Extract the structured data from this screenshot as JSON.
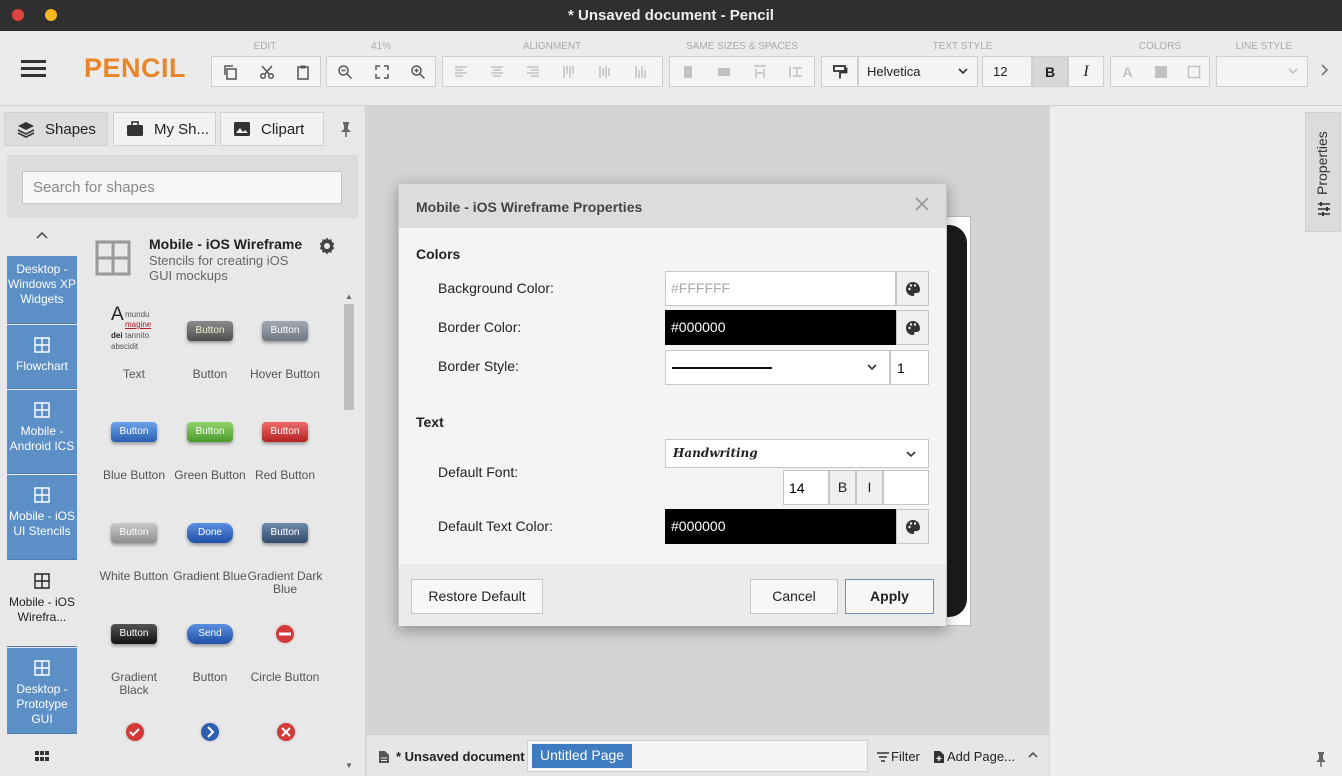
{
  "window": {
    "title": "* Unsaved document - Pencil"
  },
  "app": {
    "logo": "PENCIL"
  },
  "toolbar": {
    "groups": {
      "edit": "EDIT",
      "zoom": "41%",
      "alignment": "ALIGNMENT",
      "same_sizes": "SAME SIZES & SPACES",
      "text_style": "TEXT STYLE",
      "colors": "COLORS",
      "line_style": "LINE STYLE"
    },
    "font_family": "Helvetica",
    "font_size": "12",
    "bold_label": "B",
    "italic_label": "I"
  },
  "left_panel": {
    "tabs": [
      {
        "label": "Shapes",
        "icon": "layers-icon"
      },
      {
        "label": "My Sh...",
        "icon": "briefcase-icon"
      },
      {
        "label": "Clipart",
        "icon": "image-icon"
      }
    ],
    "search": {
      "placeholder": "Search for shapes"
    },
    "collections": [
      {
        "label": "Desktop - Windows XP Widgets"
      },
      {
        "label": "Flowchart"
      },
      {
        "label": "Mobile - Android ICS"
      },
      {
        "label": "Mobile - iOS UI Stencils"
      },
      {
        "label": "Mobile - iOS Wirefra..."
      },
      {
        "label": "Desktop - Prototype GUI"
      }
    ],
    "stencil": {
      "title": "Mobile - iOS Wireframe",
      "description": "Stencils for creating iOS GUI mockups"
    },
    "shapes": [
      {
        "label": "Text"
      },
      {
        "label": "Button",
        "thumb_text": "Button"
      },
      {
        "label": "Hover Button",
        "thumb_text": "Button"
      },
      {
        "label": "Blue Button",
        "thumb_text": "Button"
      },
      {
        "label": "Green Button",
        "thumb_text": "Button"
      },
      {
        "label": "Red Button",
        "thumb_text": "Button"
      },
      {
        "label": "White Button",
        "thumb_text": "Button"
      },
      {
        "label": "Gradient Blue",
        "thumb_text": "Done"
      },
      {
        "label": "Gradient Dark Blue",
        "thumb_text": "Button"
      },
      {
        "label": "Gradient Black",
        "thumb_text": "Button"
      },
      {
        "label": "Button",
        "thumb_text": "Send"
      },
      {
        "label": "Circle Button"
      }
    ],
    "text_thumb": {
      "big": "A",
      "l1": "mundu",
      "l2": "magine",
      "l3": "dei",
      "l3b": "tannito",
      "l4": "abscidit"
    }
  },
  "right_panel": {
    "properties_label": "Properties"
  },
  "status_bar": {
    "document_name": "* Unsaved document",
    "page_name": "Untitled Page",
    "filter_label": "Filter",
    "add_page_label": "Add Page..."
  },
  "dialog": {
    "title": "Mobile - iOS Wireframe Properties",
    "colors_section": "Colors",
    "background_color_label": "Background Color:",
    "background_color_value": "#FFFFFF",
    "border_color_label": "Border Color:",
    "border_color_value": "#000000",
    "border_style_label": "Border Style:",
    "border_width": "1",
    "text_section": "Text",
    "default_font_label": "Default Font:",
    "default_font_value": "Handwriting",
    "font_size": "14",
    "bold_label": "B",
    "italic_label": "I",
    "default_text_color_label": "Default Text Color:",
    "default_text_color_value": "#000000",
    "restore_label": "Restore Default",
    "cancel_label": "Cancel",
    "apply_label": "Apply"
  },
  "colors": {
    "accent_orange": "#e8862a",
    "collection_blue": "#5b8fc5",
    "page_tab_blue": "#3e7bbf"
  }
}
